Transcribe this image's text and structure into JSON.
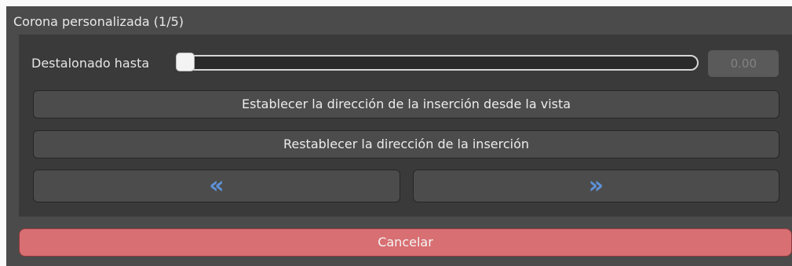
{
  "panel": {
    "title": "Corona personalizada (1/5)"
  },
  "slider": {
    "label": "Destalonado hasta",
    "value_text": "0.00",
    "level_fraction": 0
  },
  "buttons": {
    "set_direction": "Establecer la dirección de la inserción desde la vista",
    "reset_direction": "Restablecer la dirección de la inserción",
    "prev_icon": "double-chevron-left-icon",
    "next_icon": "double-chevron-right-icon",
    "prev_glyph": "«",
    "next_glyph": "»"
  },
  "cancel": {
    "label": "Cancelar"
  },
  "colors": {
    "panel_bg": "#4b4b4b",
    "inner_bg": "#3a3a3a",
    "chevron_blue": "#5d92d8",
    "cancel_red": "#d86f72"
  }
}
